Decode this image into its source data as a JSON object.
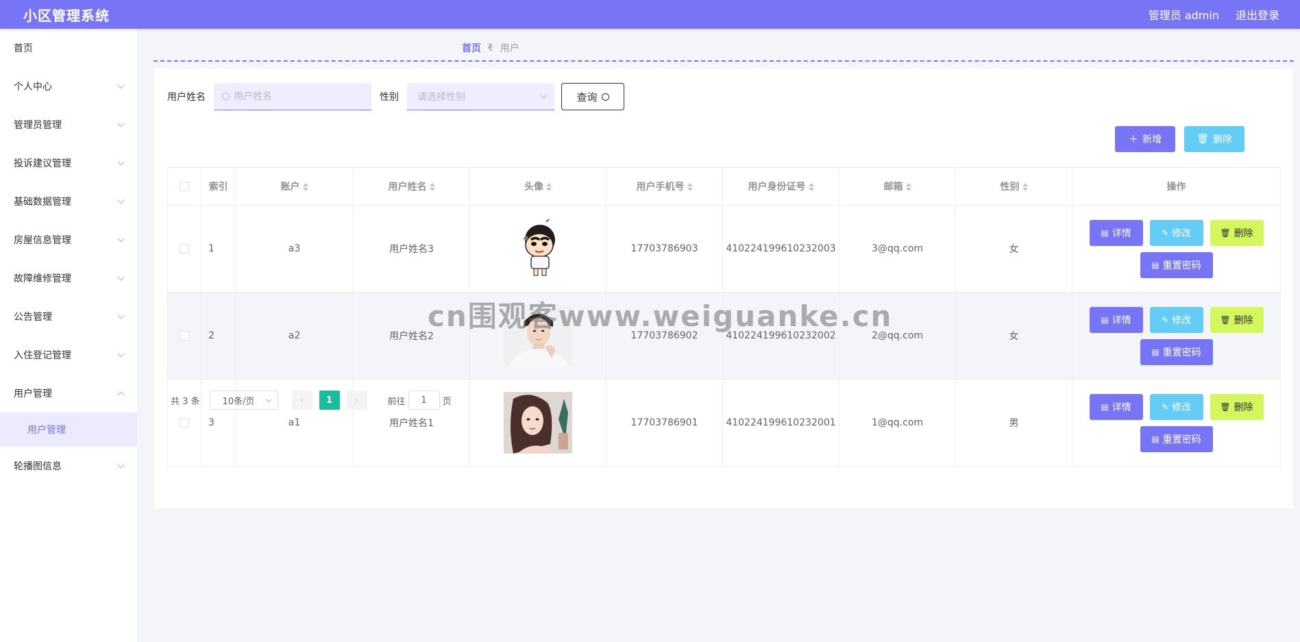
{
  "app": {
    "title": "小区管理系统",
    "user_label": "管理员 admin",
    "logout_label": "退出登录"
  },
  "colors": {
    "primary": "#7774f6",
    "info": "#64cdf6",
    "warning": "#d5f75e",
    "page_active": "#1abc9c"
  },
  "sidebar": {
    "items": [
      {
        "label": "首页",
        "icon": "",
        "expandable": false
      },
      {
        "label": "个人中心",
        "icon": "chevron-down-icon",
        "expandable": true
      },
      {
        "label": "管理员管理",
        "icon": "chevron-down-icon",
        "expandable": true
      },
      {
        "label": "投诉建议管理",
        "icon": "chevron-down-icon",
        "expandable": true
      },
      {
        "label": "基础数据管理",
        "icon": "chevron-down-icon",
        "expandable": true
      },
      {
        "label": "房屋信息管理",
        "icon": "chevron-down-icon",
        "expandable": true
      },
      {
        "label": "故障维修管理",
        "icon": "chevron-down-icon",
        "expandable": true
      },
      {
        "label": "公告管理",
        "icon": "chevron-down-icon",
        "expandable": true
      },
      {
        "label": "入住登记管理",
        "icon": "chevron-down-icon",
        "expandable": true
      },
      {
        "label": "用户管理",
        "icon": "chevron-up-icon",
        "expandable": true
      },
      {
        "label": "轮播图信息",
        "icon": "chevron-down-icon",
        "expandable": true
      }
    ],
    "active_sub": "用户管理"
  },
  "breadcrumb": {
    "home": "首页",
    "separator": "✌",
    "current": "用户"
  },
  "search": {
    "name_label": "用户姓名",
    "name_placeholder": "用户姓名",
    "gender_label": "性别",
    "gender_placeholder": "请选择性别",
    "query_label": "查询"
  },
  "toolbar": {
    "add_label": "新增",
    "delete_label": "删除"
  },
  "table": {
    "headers": {
      "index": "索引",
      "account": "账户",
      "name": "用户姓名",
      "avatar": "头像",
      "phone": "用户手机号",
      "id_card": "用户身份证号",
      "email": "邮箱",
      "gender": "性别",
      "actions": "操作"
    },
    "rows": [
      {
        "index": "1",
        "account": "a3",
        "name": "用户姓名3",
        "avatar": "cartoon-boy-avatar",
        "phone": "17703786903",
        "id_card": "410224199610232003",
        "email": "3@qq.com",
        "gender": "女"
      },
      {
        "index": "2",
        "account": "a2",
        "name": "用户姓名2",
        "avatar": "young-man-photo-avatar",
        "phone": "17703786902",
        "id_card": "410224199610232002",
        "email": "2@qq.com",
        "gender": "女"
      },
      {
        "index": "3",
        "account": "a1",
        "name": "用户姓名1",
        "avatar": "anime-girl-avatar",
        "phone": "17703786901",
        "id_card": "410224199610232001",
        "email": "1@qq.com",
        "gender": "男"
      }
    ],
    "action_labels": {
      "detail": "详情",
      "edit": "修改",
      "delete": "删除",
      "reset": "重置密码"
    }
  },
  "pagination": {
    "total_text": "共 3 条",
    "page_size": "10条/页",
    "current_page": "1",
    "goto_prefix": "前往",
    "goto_value": "1",
    "goto_suffix": "页"
  },
  "watermark": "cn围观客www.weiguanke.cn"
}
